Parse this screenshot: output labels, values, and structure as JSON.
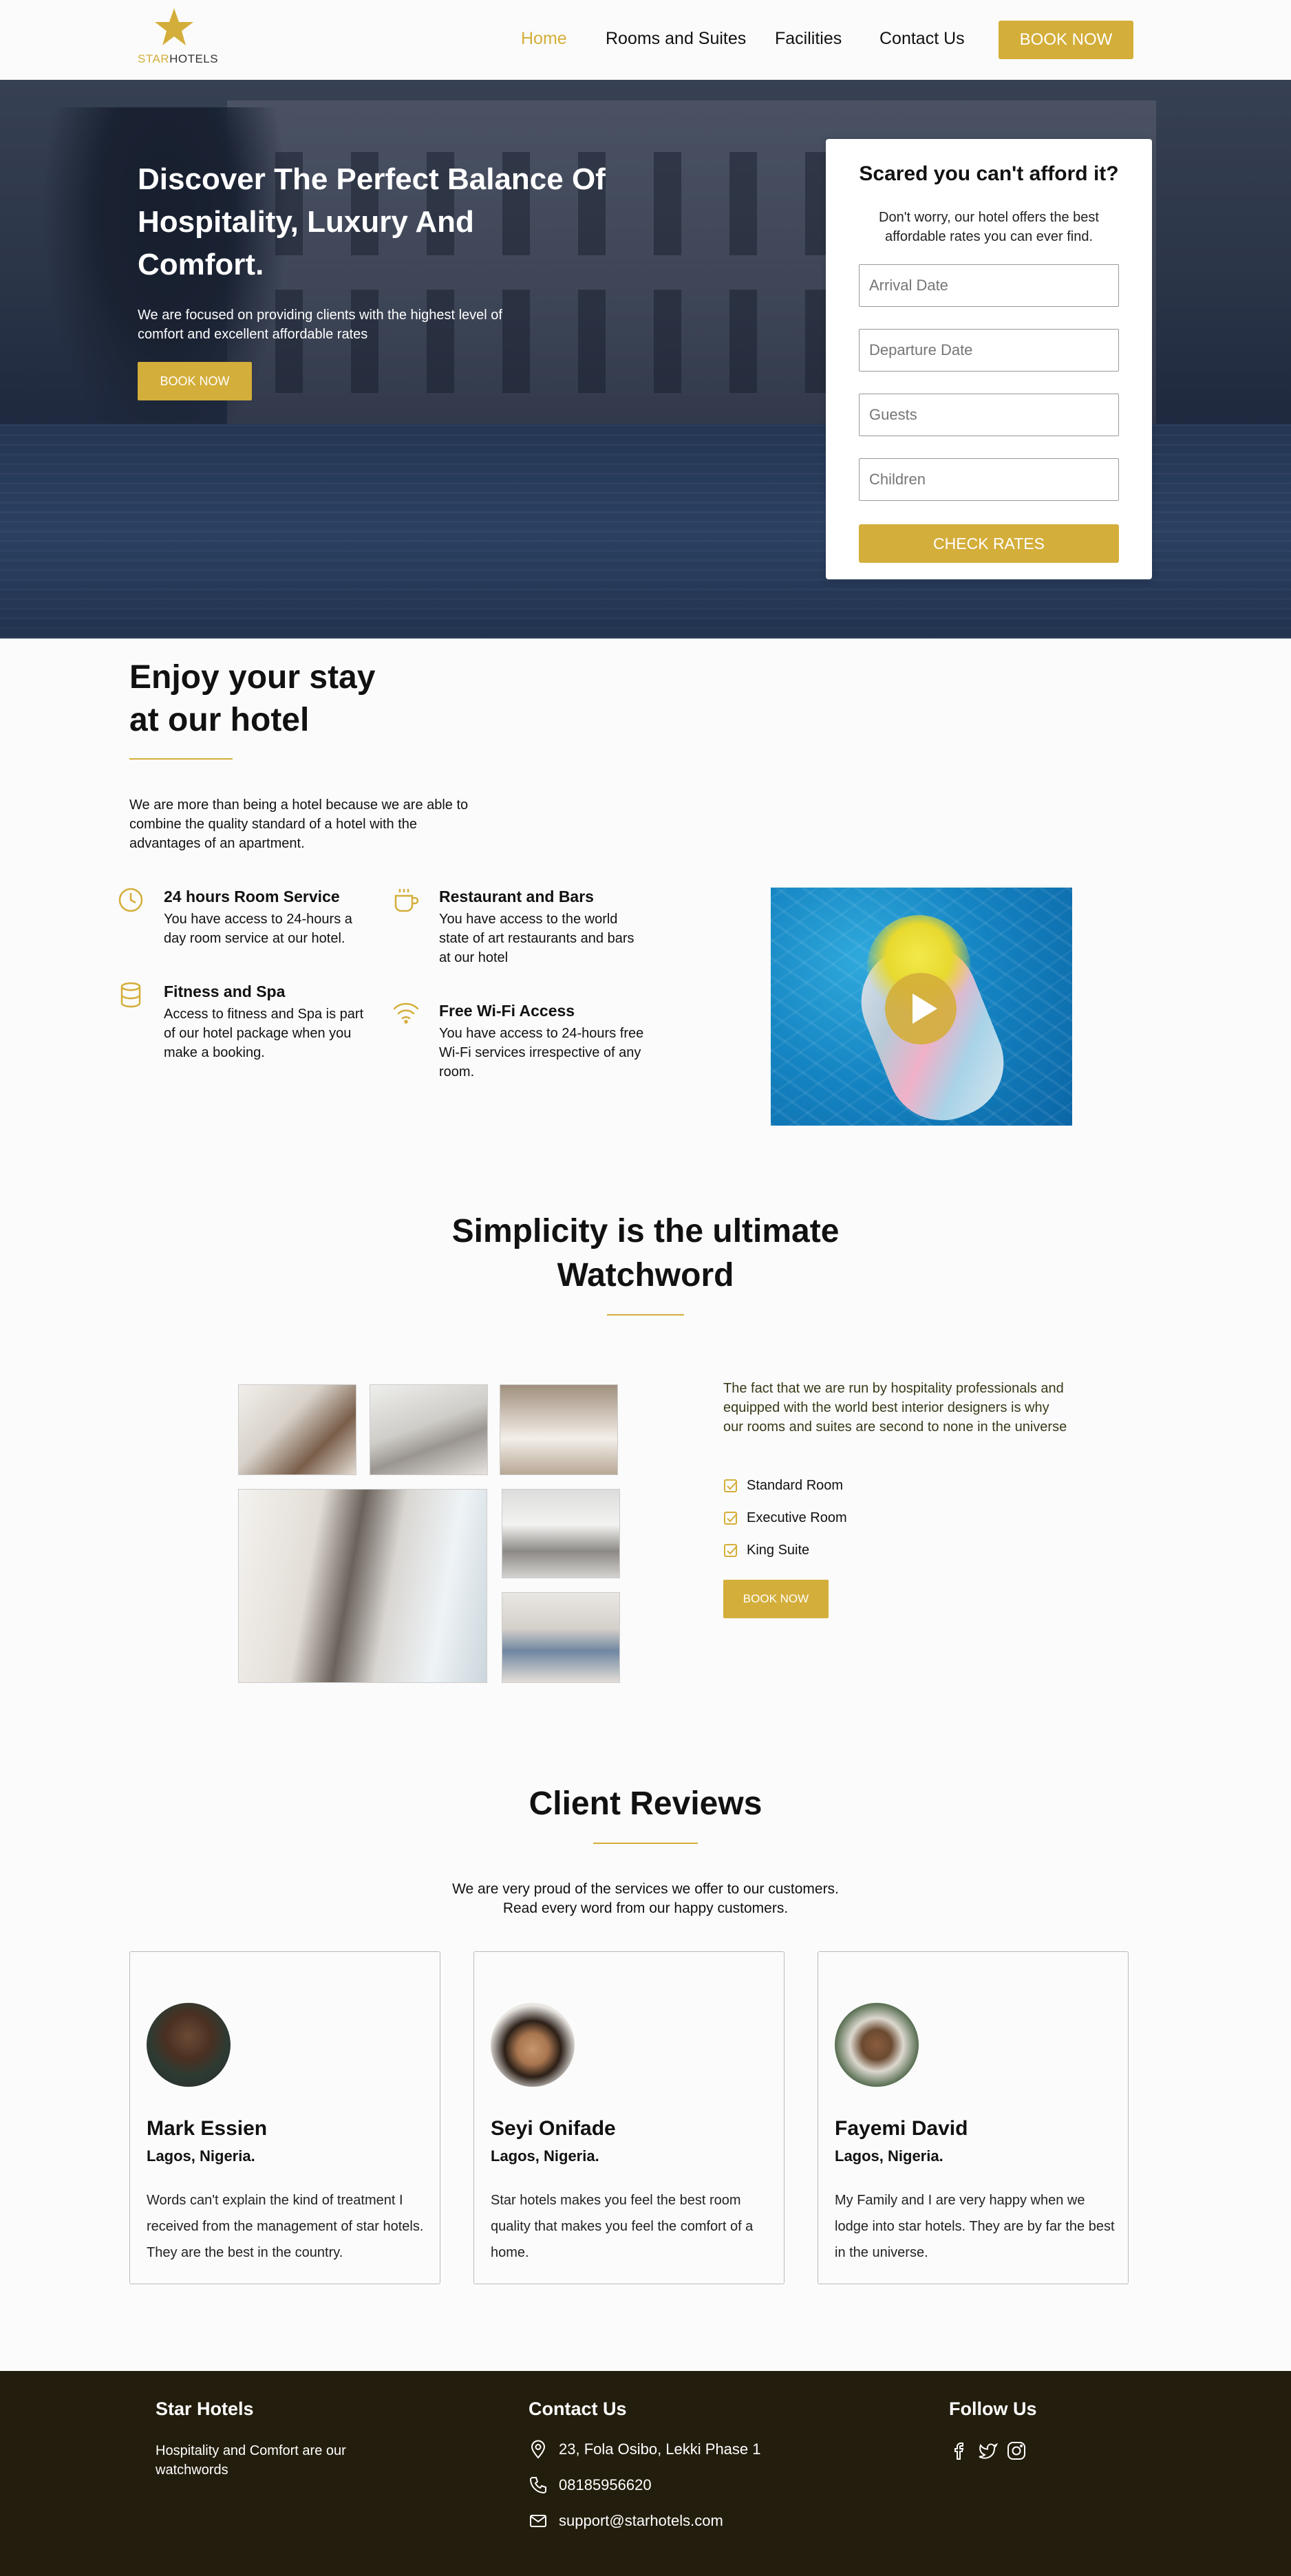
{
  "nav": {
    "logo_star": "STAR",
    "logo_hotels": "HOTELS",
    "links": [
      "Home",
      "Rooms and Suites",
      "Facilities",
      "Contact Us"
    ],
    "active": "Home",
    "book_label": "BOOK NOW"
  },
  "hero": {
    "title": "Discover The Perfect Balance Of Hospitality, Luxury And Comfort.",
    "subtitle": "We are focused on providing clients with the highest level of comfort and excellent affordable rates",
    "book_label": "BOOK NOW"
  },
  "form": {
    "title": "Scared you can't afford it?",
    "subtitle": "Don't worry, our hotel offers the best affordable rates you can ever find.",
    "fields": [
      "Arrival Date",
      "Departure Date",
      "Guests",
      "Children"
    ],
    "button": "CHECK RATES"
  },
  "enjoy": {
    "title_line1": "Enjoy your stay",
    "title_line2": "at our hotel",
    "intro": "We are more than being a hotel because we are able to combine the quality standard of a hotel with the advantages of an apartment.",
    "features": [
      {
        "icon": "clock-icon",
        "title": "24 hours Room Service",
        "desc": "You have access to 24-hours a day room service at our hotel."
      },
      {
        "icon": "cup-icon",
        "title": "Restaurant and Bars",
        "desc": "You have access to the world state of art restaurants and bars at our hotel"
      },
      {
        "icon": "database-icon",
        "title": "Fitness and Spa",
        "desc": "Access to fitness and Spa is part of our hotel package when you make a booking."
      },
      {
        "icon": "wifi-icon",
        "title": "Free Wi-Fi Access",
        "desc": "You have access to 24-hours free Wi-Fi services irrespective of any room."
      }
    ],
    "video_icon": "play-icon"
  },
  "simplicity": {
    "title_line1": "Simplicity is the ultimate",
    "title_line2": "Watchword",
    "text": "The fact that we are run by hospitality professionals and equipped with the world best interior designers is why our rooms and suites are second to none in the universe",
    "rooms": [
      "Standard Room",
      "Executive Room",
      "King Suite"
    ],
    "book_label": "BOOK NOW"
  },
  "reviews": {
    "title": "Client Reviews",
    "subtitle_line1": "We are very proud of the services we offer to our customers.",
    "subtitle_line2": "Read every word from our happy customers.",
    "items": [
      {
        "name": "Mark Essien",
        "location": "Lagos, Nigeria.",
        "text": "Words can't explain the kind of treatment I received from the management of star hotels. They are the best in the country."
      },
      {
        "name": "Seyi Onifade",
        "location": "Lagos, Nigeria.",
        "text": "Star hotels makes you feel the best room quality that makes you feel the comfort of a home."
      },
      {
        "name": "Fayemi David",
        "location": "Lagos, Nigeria.",
        "text": "My Family and I are very happy when we lodge into star hotels. They are by far the best in the universe."
      }
    ]
  },
  "footer": {
    "brand": "Star Hotels",
    "tagline": "Hospitality and Comfort are our watchwords",
    "contact_title": "Contact Us",
    "address": "23, Fola Osibo, Lekki Phase 1",
    "phone": "08185956620",
    "email": "support@starhotels.com",
    "follow_title": "Follow Us",
    "social_icons": [
      "facebook-icon",
      "twitter-icon",
      "instagram-icon"
    ]
  },
  "colors": {
    "accent": "#d4ae3a",
    "footer_bg": "#231d0d",
    "text": "#111111"
  }
}
